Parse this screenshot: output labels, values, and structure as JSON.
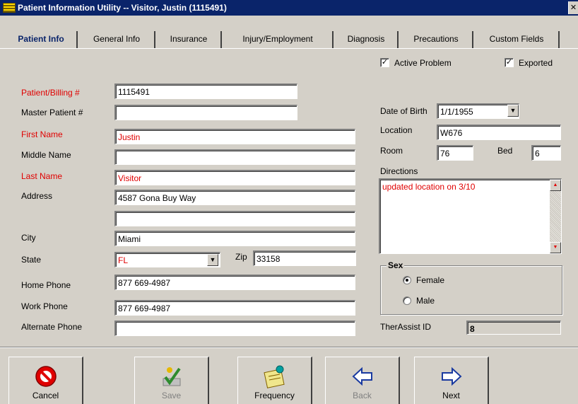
{
  "window": {
    "title": "Patient Information Utility -- Visitor, Justin (1115491)"
  },
  "tabs": [
    {
      "label": "Patient Info"
    },
    {
      "label": "General Info"
    },
    {
      "label": "Insurance"
    },
    {
      "label": "Injury/Employment"
    },
    {
      "label": "Diagnosis"
    },
    {
      "label": "Precautions"
    },
    {
      "label": "Custom Fields"
    }
  ],
  "flags": {
    "active_problem": {
      "label": "Active Problem",
      "checked": true
    },
    "exported": {
      "label": "Exported",
      "checked": true
    }
  },
  "form": {
    "patient_billing": {
      "label": "Patient/Billing #",
      "value": "1115491"
    },
    "master_patient": {
      "label": "Master Patient #",
      "value": ""
    },
    "first_name": {
      "label": "First Name",
      "value": "Justin"
    },
    "middle_name": {
      "label": "Middle Name",
      "value": ""
    },
    "last_name": {
      "label": "Last Name",
      "value": "Visitor"
    },
    "address": {
      "label": "Address",
      "value": "4587 Gona Buy Way",
      "value2": ""
    },
    "city": {
      "label": "City",
      "value": "Miami"
    },
    "state": {
      "label": "State",
      "value": "FL"
    },
    "zip": {
      "label": "Zip",
      "value": "33158"
    },
    "home_phone": {
      "label": "Home Phone",
      "value": "877 669-4987"
    },
    "work_phone": {
      "label": "Work Phone",
      "value": "877 669-4987"
    },
    "alternate_phone": {
      "label": "Alternate Phone",
      "value": ""
    }
  },
  "right": {
    "dob": {
      "label": "Date of Birth",
      "value": "1/1/1955"
    },
    "location": {
      "label": "Location",
      "value": "W676"
    },
    "room": {
      "label": "Room",
      "value": "76"
    },
    "bed": {
      "label": "Bed",
      "value": "6"
    },
    "directions": {
      "label": "Directions",
      "value": "updated location on 3/10"
    },
    "sex": {
      "label": "Sex",
      "female": "Female",
      "male": "Male",
      "selected": "Female"
    },
    "therassist": {
      "label": "TherAssist ID",
      "value": "8"
    }
  },
  "toolbar": {
    "cancel": "Cancel",
    "save": "Save",
    "frequency": "Frequency",
    "back": "Back",
    "next": "Next"
  },
  "colors": {
    "required_label": "#e00000",
    "title_bar": "#0a246a",
    "accent": "#0a246a"
  }
}
